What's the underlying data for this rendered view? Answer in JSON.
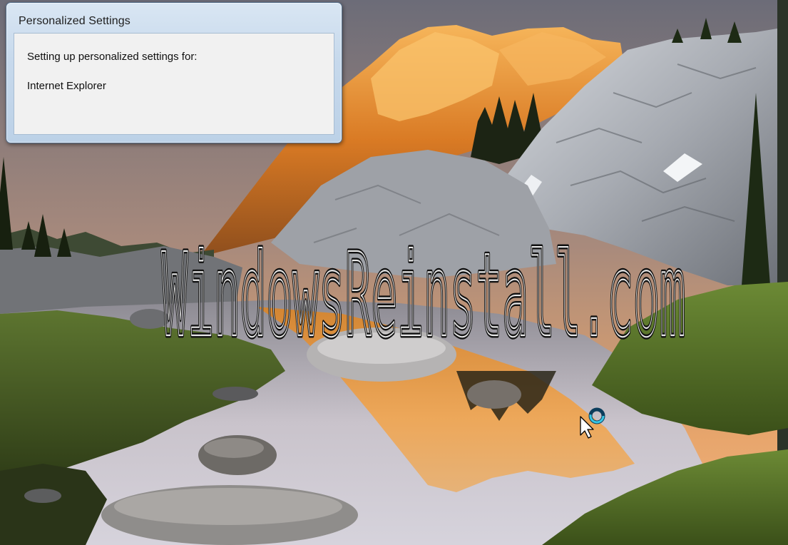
{
  "dialog": {
    "title": "Personalized Settings",
    "message": "Setting up personalized settings for:",
    "component": "Internet Explorer"
  },
  "watermark": {
    "text": "WindowsReinstall.com"
  },
  "cursor": {
    "icon": "busy-arrow-icon"
  },
  "colors": {
    "sky": "#f0b07a",
    "grass": "#4f6b2a",
    "water": "#c8c2c8",
    "rock": "#8f9296",
    "sunlit_rock": "#e2852a"
  }
}
